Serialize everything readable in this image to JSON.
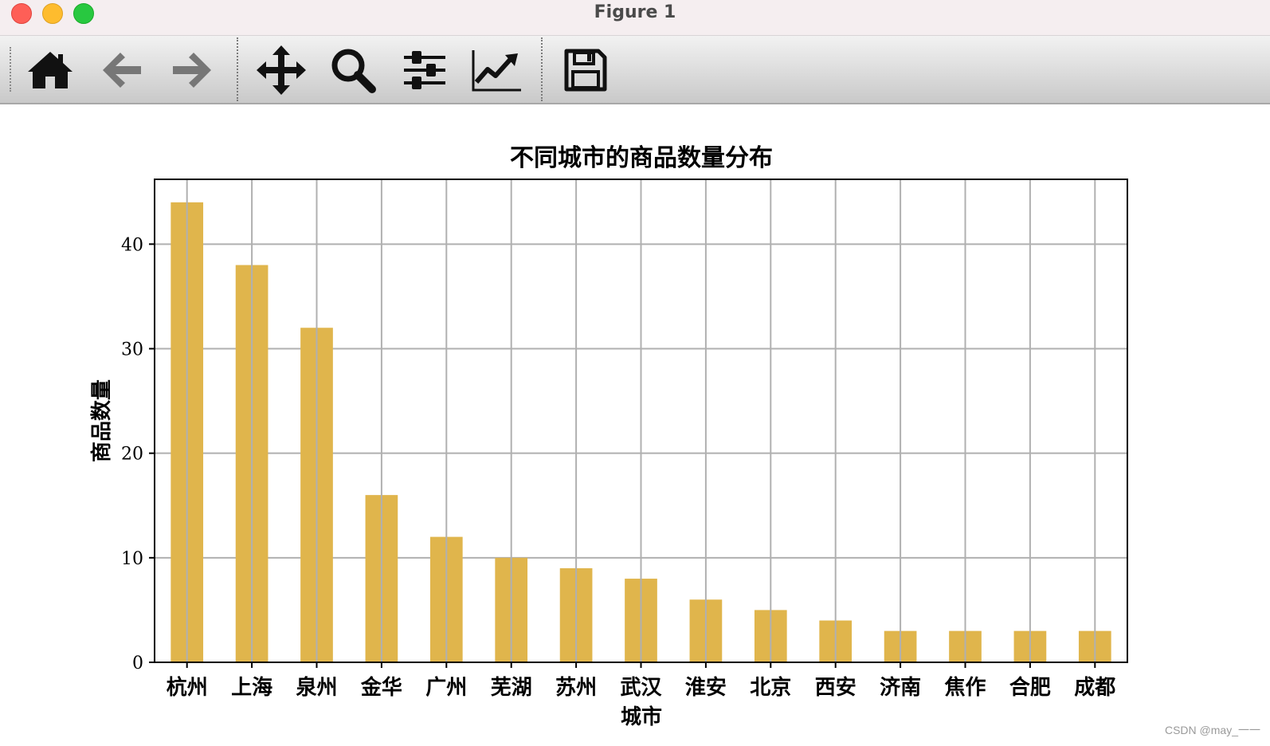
{
  "window": {
    "title": "Figure 1"
  },
  "toolbar": {
    "buttons": [
      {
        "name": "home-icon"
      },
      {
        "name": "back-icon"
      },
      {
        "name": "forward-icon"
      },
      {
        "name": "pan-icon"
      },
      {
        "name": "zoom-icon"
      },
      {
        "name": "configure-subplots-icon"
      },
      {
        "name": "edit-axes-icon"
      },
      {
        "name": "save-icon"
      }
    ]
  },
  "chart_data": {
    "type": "bar",
    "title": "不同城市的商品数量分布",
    "xlabel": "城市",
    "ylabel": "商品数量",
    "categories": [
      "杭州",
      "上海",
      "泉州",
      "金华",
      "广州",
      "芜湖",
      "苏州",
      "武汉",
      "淮安",
      "北京",
      "西安",
      "济南",
      "焦作",
      "合肥",
      "成都"
    ],
    "values": [
      44,
      38,
      32,
      16,
      12,
      10,
      9,
      8,
      6,
      5,
      4,
      3,
      3,
      3,
      3
    ],
    "yticks": [
      0,
      10,
      20,
      30,
      40
    ],
    "ylim": [
      0,
      46.2
    ],
    "grid": true,
    "bar_color": "#e0b54c"
  },
  "watermark": "CSDN @may_一一"
}
